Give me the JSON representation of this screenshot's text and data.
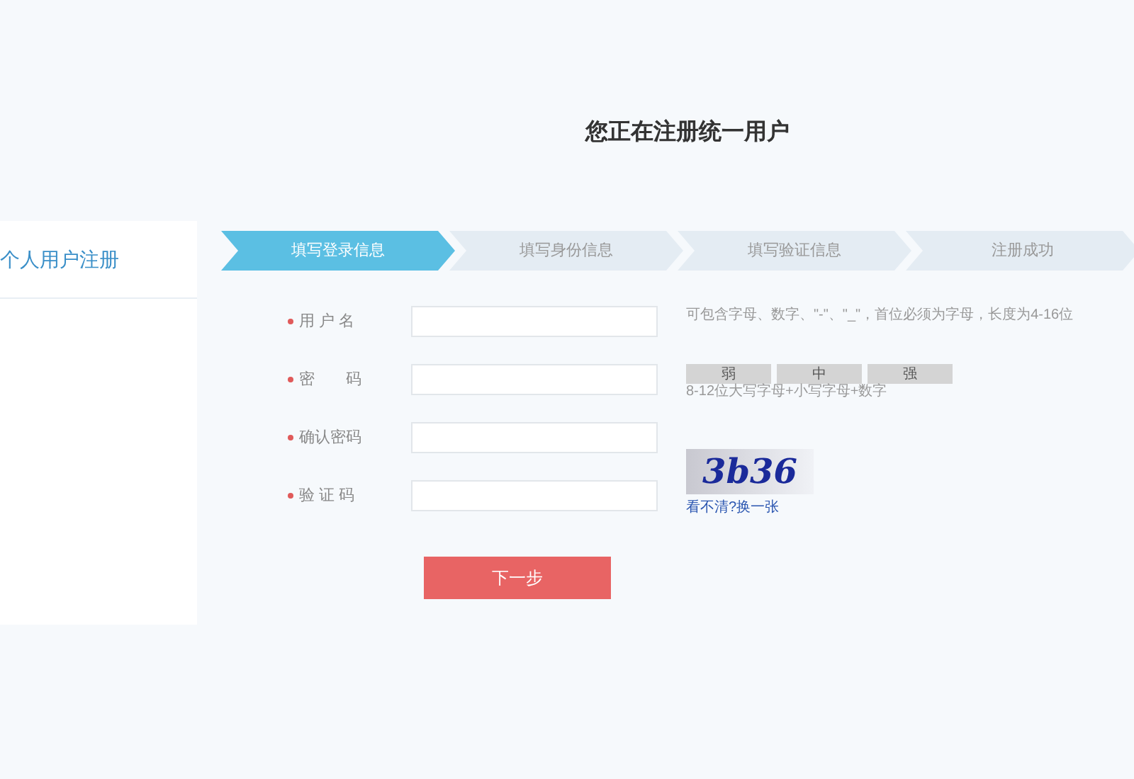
{
  "page_title": "您正在注册统一用户",
  "sidebar": {
    "heading": "个人用户注册"
  },
  "steps": [
    {
      "label": "填写登录信息",
      "selected": true
    },
    {
      "label": "填写身份信息",
      "selected": false
    },
    {
      "label": "填写验证信息",
      "selected": false
    },
    {
      "label": "注册成功",
      "selected": false
    }
  ],
  "fields": [
    {
      "label": "用 户 名",
      "required": true,
      "hint": {
        "kind": "text",
        "text": "可包含字母、数字、\"-\"、\"_\"，首位必须为字母，长度为4-16位"
      }
    },
    {
      "label": "密　　码",
      "required": true,
      "hint": {
        "kind": "strength",
        "levels": [
          "弱",
          "中",
          "强"
        ],
        "text": "8-12位大写字母+小写字母+数字"
      }
    },
    {
      "label": "确认密码",
      "required": true
    },
    {
      "label": "验 证 码",
      "required": true,
      "hint": {
        "kind": "captcha",
        "code": "3b36",
        "link": "看不清?换一张"
      }
    }
  ],
  "submit": "下一步"
}
